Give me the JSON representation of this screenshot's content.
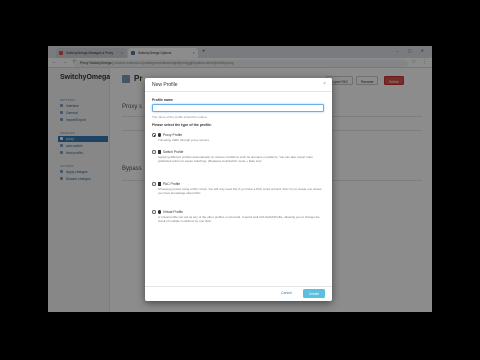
{
  "browser": {
    "tabs": [
      {
        "label": "SwitchyOmega Manages a Proxy"
      },
      {
        "label": "SwitchyOmega Options"
      }
    ],
    "new_tab": "+",
    "window_controls": "– ▢ ✕",
    "address": {
      "prefix": "Proxy SwitchyOmega",
      "url": "chrome-extension://padekgcemlokbadohgkifijomclgjgif/options.html#!/profile/proxy"
    }
  },
  "sidebar": {
    "brand": "SwitchyOmega",
    "sections": [
      {
        "title": "Settings",
        "items": [
          {
            "label": "Interface"
          },
          {
            "label": "General"
          },
          {
            "label": "Import/Export"
          }
        ]
      },
      {
        "title": "Profiles",
        "items": [
          {
            "label": "proxy",
            "active": true
          },
          {
            "label": "auto switch"
          },
          {
            "label": "New profile..."
          }
        ]
      },
      {
        "title": "Actions",
        "items": [
          {
            "label": "Apply changes"
          },
          {
            "label": "Discard changes"
          }
        ]
      }
    ]
  },
  "main": {
    "title": "Pr",
    "section1": "Proxy s",
    "section2": "Bypass",
    "buttons": {
      "export": "Export PAC",
      "rename": "Rename",
      "delete": "Delete"
    }
  },
  "modal": {
    "title": "New Profile",
    "close": "×",
    "name_label": "Profile name",
    "name_value": "",
    "name_help": "The name of the profile should be unique.",
    "type_label": "Please select the type of the profile:",
    "options": [
      {
        "name": "Proxy Profile",
        "icon": "globe-icon",
        "selected": true,
        "desc": "Tunneling traffic through proxy servers."
      },
      {
        "name": "Switch Profile",
        "icon": "switch-icon",
        "selected": false,
        "desc": "Applying different profiles automatically on various conditions such as domains or patterns. You can also import rules published online for easier switching. (Replaces AutoSwitch mode + Rule List)"
      },
      {
        "name": "PAC Profile",
        "icon": "file-icon",
        "selected": false,
        "desc": "Choosing proxies using a PAC script. You will only need this if you have a PAC script at hand. Don't try to create one unless you have knowledge about PAC."
      },
      {
        "name": "Virtual Profile",
        "icon": "question-icon",
        "selected": false,
        "desc": "A virtual profile can act as any of the other profiles on demand. It works well with SwitchProfile, allowing you to change the result of multiple conditions by one click."
      }
    ],
    "cancel": "Cancel",
    "create": "Create"
  }
}
